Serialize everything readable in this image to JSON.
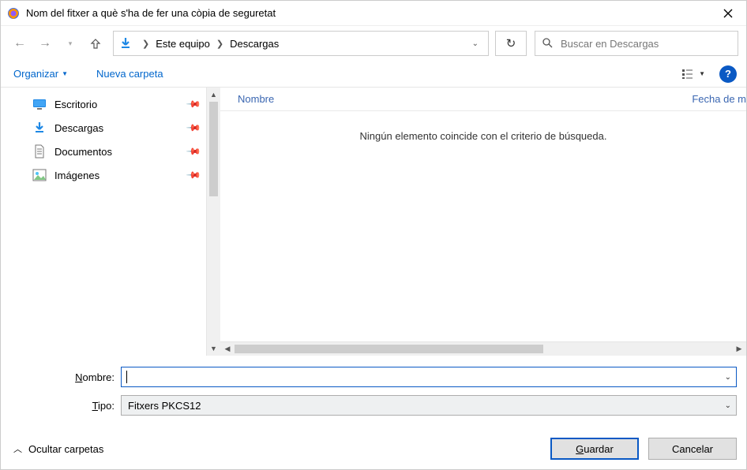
{
  "window": {
    "title": "Nom del fitxer a què s'ha de fer una còpia de seguretat"
  },
  "breadcrumb": {
    "root": "Este equipo",
    "current": "Descargas"
  },
  "search": {
    "placeholder": "Buscar en Descargas"
  },
  "toolbar": {
    "organize": "Organizar",
    "new_folder": "Nueva carpeta"
  },
  "sidebar": {
    "items": [
      {
        "label": "Escritorio",
        "icon": "desktop"
      },
      {
        "label": "Descargas",
        "icon": "download"
      },
      {
        "label": "Documentos",
        "icon": "document"
      },
      {
        "label": "Imágenes",
        "icon": "picture"
      }
    ]
  },
  "columns": {
    "name": "Nombre",
    "date": "Fecha de m"
  },
  "content": {
    "empty_message": "Ningún elemento coincide con el criterio de búsqueda."
  },
  "form": {
    "name_label_prefix": "N",
    "name_label_rest": "ombre:",
    "name_value": "",
    "type_label_prefix": "T",
    "type_label_rest": "ipo:",
    "type_value": "Fitxers PKCS12"
  },
  "footer": {
    "hide_folders": "Ocultar carpetas",
    "save_prefix": "G",
    "save_rest": "uardar",
    "cancel": "Cancelar"
  }
}
